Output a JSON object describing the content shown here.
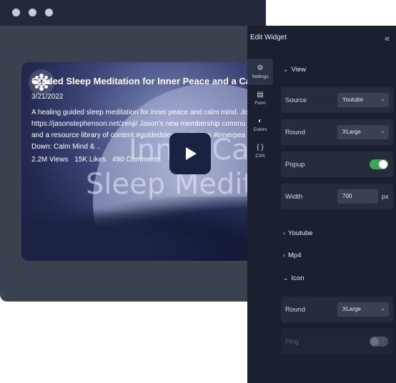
{
  "browser": {
    "video": {
      "title": "Guided Sleep Meditation for Inner Peace and a Calm",
      "date": "3/21/2022",
      "description_lines": [
        "A healing guided sleep meditation for inner peace and calm mind. Jo",
        "https://jasonstephenson.net/zenji/ Jason's new membership commu",
        "and a resource library of content.#guidedsleepmeditation #innerpea",
        "Down: Calm Mind & .."
      ],
      "stats": {
        "views": "2.2M Views",
        "likes": "15K Likes",
        "comments": "490 Comments"
      },
      "thumbnail_text": [
        "Inner Calm",
        "Sleep Medita"
      ]
    }
  },
  "panel": {
    "title": "Edit Widget",
    "nav": [
      {
        "label": "Settings",
        "icon": "gear-icon",
        "active": true
      },
      {
        "label": "Form",
        "icon": "form-icon",
        "active": false
      },
      {
        "label": "Colors",
        "icon": "palette-icon",
        "active": false
      },
      {
        "label": "CSS",
        "icon": "code-braces-icon",
        "active": false
      }
    ],
    "view_section": {
      "label": "View",
      "source_label": "Source",
      "source_value": "Youtube",
      "round_label": "Round",
      "round_value": "XLarge",
      "popup_label": "Popup",
      "popup_on": true,
      "width_label": "Width",
      "width_value": "700",
      "width_unit": "px"
    },
    "youtube_section": {
      "label": "Youtube"
    },
    "mp4_section": {
      "label": "Mp4"
    },
    "icon_section": {
      "label": "Icon",
      "round_label": "Round",
      "round_value": "XLarge",
      "ping_label": "Ping",
      "ping_on": false
    }
  },
  "colors": {
    "accent_green": "#3aa655",
    "panel_bg": "#1b2030",
    "row_bg": "#262c3c"
  }
}
